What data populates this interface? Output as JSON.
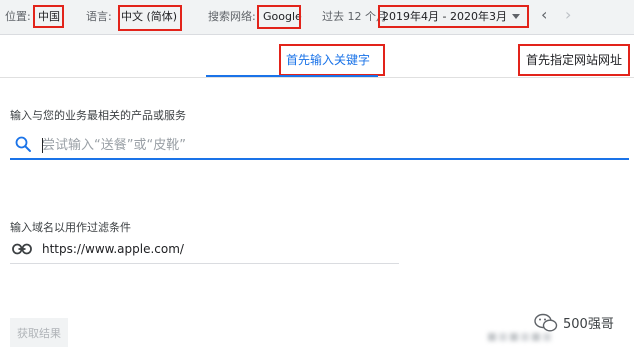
{
  "topbar": {
    "location_label": "位置:",
    "location_value": "中国",
    "language_label": "语言:",
    "language_value": "中文 (简体)",
    "network_label": "搜索网络:",
    "network_value": "Google",
    "period_label": "过去 12 个月",
    "period_value": "2019年4月 - 2020年3月",
    "prev_icon": "‹",
    "next_icon": "›"
  },
  "tabs": {
    "keyword_label": "首先输入关键字",
    "website_label": "首先指定网站网址"
  },
  "form": {
    "products_label": "输入与您的业务最相关的产品或服务",
    "search_placeholder": "尝试输入“送餐”或“皮靴”",
    "domain_label": "输入域名以用作过滤条件",
    "domain_value": "https://www.apple.com/",
    "submit_label": "获取结果"
  },
  "watermark": {
    "text": "500强哥"
  },
  "colors": {
    "accent": "#1a73e8",
    "highlight_box": "#e2231a",
    "topbar_bg": "#f1f3f4"
  },
  "icons": {
    "search": "search-icon",
    "link": "link-icon",
    "dropdown": "dropdown-arrow-icon",
    "wechat": "wechat-icon"
  }
}
